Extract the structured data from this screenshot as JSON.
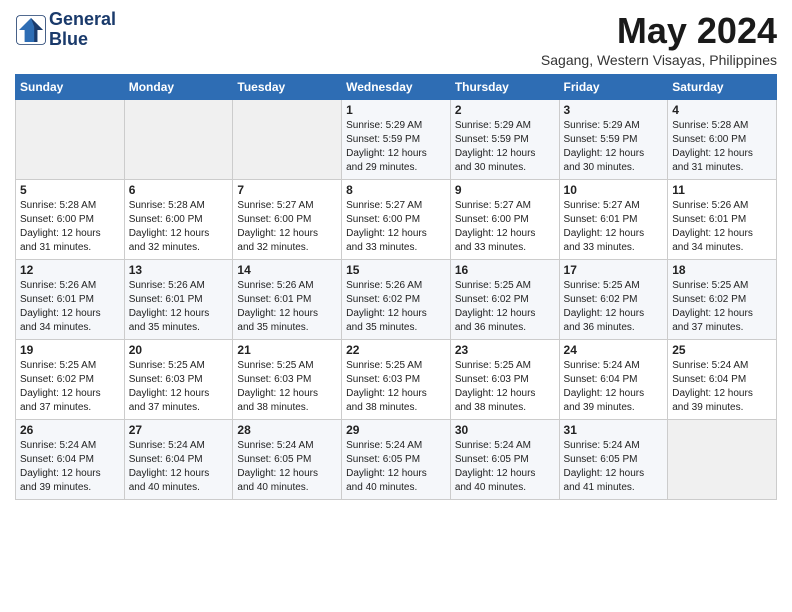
{
  "header": {
    "logo_line1": "General",
    "logo_line2": "Blue",
    "month": "May 2024",
    "location": "Sagang, Western Visayas, Philippines"
  },
  "weekdays": [
    "Sunday",
    "Monday",
    "Tuesday",
    "Wednesday",
    "Thursday",
    "Friday",
    "Saturday"
  ],
  "weeks": [
    [
      {
        "day": "",
        "info": ""
      },
      {
        "day": "",
        "info": ""
      },
      {
        "day": "",
        "info": ""
      },
      {
        "day": "1",
        "info": "Sunrise: 5:29 AM\nSunset: 5:59 PM\nDaylight: 12 hours\nand 29 minutes."
      },
      {
        "day": "2",
        "info": "Sunrise: 5:29 AM\nSunset: 5:59 PM\nDaylight: 12 hours\nand 30 minutes."
      },
      {
        "day": "3",
        "info": "Sunrise: 5:29 AM\nSunset: 5:59 PM\nDaylight: 12 hours\nand 30 minutes."
      },
      {
        "day": "4",
        "info": "Sunrise: 5:28 AM\nSunset: 6:00 PM\nDaylight: 12 hours\nand 31 minutes."
      }
    ],
    [
      {
        "day": "5",
        "info": "Sunrise: 5:28 AM\nSunset: 6:00 PM\nDaylight: 12 hours\nand 31 minutes."
      },
      {
        "day": "6",
        "info": "Sunrise: 5:28 AM\nSunset: 6:00 PM\nDaylight: 12 hours\nand 32 minutes."
      },
      {
        "day": "7",
        "info": "Sunrise: 5:27 AM\nSunset: 6:00 PM\nDaylight: 12 hours\nand 32 minutes."
      },
      {
        "day": "8",
        "info": "Sunrise: 5:27 AM\nSunset: 6:00 PM\nDaylight: 12 hours\nand 33 minutes."
      },
      {
        "day": "9",
        "info": "Sunrise: 5:27 AM\nSunset: 6:00 PM\nDaylight: 12 hours\nand 33 minutes."
      },
      {
        "day": "10",
        "info": "Sunrise: 5:27 AM\nSunset: 6:01 PM\nDaylight: 12 hours\nand 33 minutes."
      },
      {
        "day": "11",
        "info": "Sunrise: 5:26 AM\nSunset: 6:01 PM\nDaylight: 12 hours\nand 34 minutes."
      }
    ],
    [
      {
        "day": "12",
        "info": "Sunrise: 5:26 AM\nSunset: 6:01 PM\nDaylight: 12 hours\nand 34 minutes."
      },
      {
        "day": "13",
        "info": "Sunrise: 5:26 AM\nSunset: 6:01 PM\nDaylight: 12 hours\nand 35 minutes."
      },
      {
        "day": "14",
        "info": "Sunrise: 5:26 AM\nSunset: 6:01 PM\nDaylight: 12 hours\nand 35 minutes."
      },
      {
        "day": "15",
        "info": "Sunrise: 5:26 AM\nSunset: 6:02 PM\nDaylight: 12 hours\nand 35 minutes."
      },
      {
        "day": "16",
        "info": "Sunrise: 5:25 AM\nSunset: 6:02 PM\nDaylight: 12 hours\nand 36 minutes."
      },
      {
        "day": "17",
        "info": "Sunrise: 5:25 AM\nSunset: 6:02 PM\nDaylight: 12 hours\nand 36 minutes."
      },
      {
        "day": "18",
        "info": "Sunrise: 5:25 AM\nSunset: 6:02 PM\nDaylight: 12 hours\nand 37 minutes."
      }
    ],
    [
      {
        "day": "19",
        "info": "Sunrise: 5:25 AM\nSunset: 6:02 PM\nDaylight: 12 hours\nand 37 minutes."
      },
      {
        "day": "20",
        "info": "Sunrise: 5:25 AM\nSunset: 6:03 PM\nDaylight: 12 hours\nand 37 minutes."
      },
      {
        "day": "21",
        "info": "Sunrise: 5:25 AM\nSunset: 6:03 PM\nDaylight: 12 hours\nand 38 minutes."
      },
      {
        "day": "22",
        "info": "Sunrise: 5:25 AM\nSunset: 6:03 PM\nDaylight: 12 hours\nand 38 minutes."
      },
      {
        "day": "23",
        "info": "Sunrise: 5:25 AM\nSunset: 6:03 PM\nDaylight: 12 hours\nand 38 minutes."
      },
      {
        "day": "24",
        "info": "Sunrise: 5:24 AM\nSunset: 6:04 PM\nDaylight: 12 hours\nand 39 minutes."
      },
      {
        "day": "25",
        "info": "Sunrise: 5:24 AM\nSunset: 6:04 PM\nDaylight: 12 hours\nand 39 minutes."
      }
    ],
    [
      {
        "day": "26",
        "info": "Sunrise: 5:24 AM\nSunset: 6:04 PM\nDaylight: 12 hours\nand 39 minutes."
      },
      {
        "day": "27",
        "info": "Sunrise: 5:24 AM\nSunset: 6:04 PM\nDaylight: 12 hours\nand 40 minutes."
      },
      {
        "day": "28",
        "info": "Sunrise: 5:24 AM\nSunset: 6:05 PM\nDaylight: 12 hours\nand 40 minutes."
      },
      {
        "day": "29",
        "info": "Sunrise: 5:24 AM\nSunset: 6:05 PM\nDaylight: 12 hours\nand 40 minutes."
      },
      {
        "day": "30",
        "info": "Sunrise: 5:24 AM\nSunset: 6:05 PM\nDaylight: 12 hours\nand 40 minutes."
      },
      {
        "day": "31",
        "info": "Sunrise: 5:24 AM\nSunset: 6:05 PM\nDaylight: 12 hours\nand 41 minutes."
      },
      {
        "day": "",
        "info": ""
      }
    ]
  ]
}
